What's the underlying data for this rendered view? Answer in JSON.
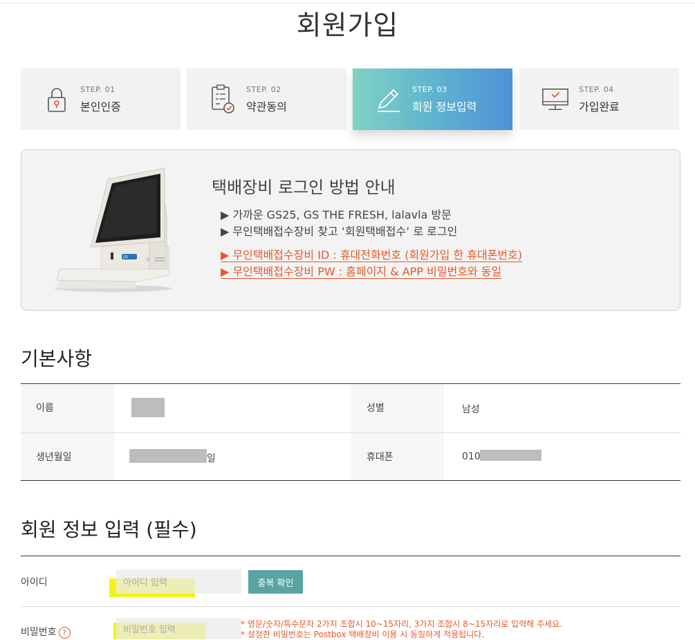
{
  "page_title": "회원가입",
  "steps": [
    {
      "num": "STEP. 01",
      "label": "본인인증",
      "icon": "lock-icon"
    },
    {
      "num": "STEP. 02",
      "label": "약관동의",
      "icon": "checklist-icon"
    },
    {
      "num": "STEP. 03",
      "label": "회원 정보입력",
      "icon": "pencil-icon",
      "active": true
    },
    {
      "num": "STEP. 04",
      "label": "가입완료",
      "icon": "monitor-check-icon"
    }
  ],
  "guide": {
    "title": "택배장비 로그인 방법 안내",
    "line1": "▶ 가까운 GS25, GS THE FRESH, lalavla 방문",
    "line2": "▶ 무인택배접수장비 찾고 ‘회원택배접수’ 로 로그인",
    "line3": "▶ 무인택배접수장비 ID : 휴대전화번호 (회원가입 한 휴대폰번호)",
    "line4": "▶ 무인택배접수장비 PW : 홈페이지 & APP 비밀번호와 동일",
    "kiosk_brand": "GS"
  },
  "basic": {
    "title": "기본사항",
    "name_label": "이름",
    "gender_label": "성별",
    "gender_value": "남성",
    "birth_label": "생년월일",
    "birth_suffix": "일",
    "phone_label": "휴대폰",
    "phone_prefix": "010"
  },
  "member": {
    "title": "회원 정보 입력 (필수)",
    "id_label": "아이디",
    "id_placeholder": "아이디 입력",
    "dup_button": "중복 확인",
    "pw_label": "비밀번호",
    "pw_placeholder": "비밀번호 입력",
    "pw_help": "?",
    "pw_note1": "* 영문/숫자/특수문자 2가지 조합시 10~15자리, 3가지 조합시 8~15자리로 입력해 주세요.",
    "pw_note2": "* 설정한 비밀번호는 Postbox 택배장비 이용 시 동일하게 적용됩니다."
  },
  "colors": {
    "accent_orange": "#e8582a",
    "button_teal": "#5aa4a2",
    "step_active_gradient": [
      "#7fd1c3",
      "#4f90d8"
    ],
    "highlight": "#f2f200"
  }
}
